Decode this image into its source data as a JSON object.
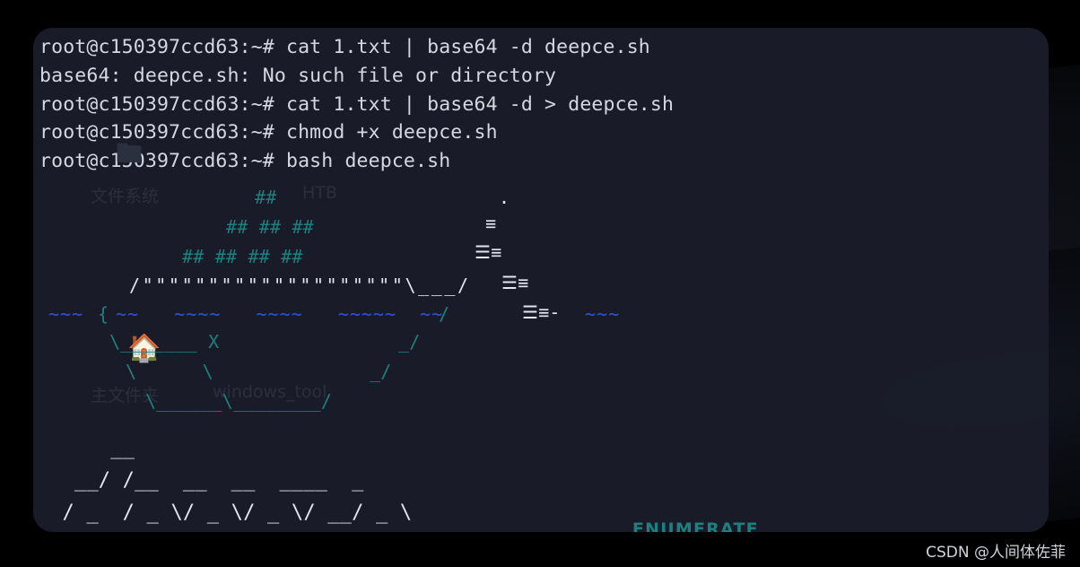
{
  "window": {
    "title": "root@c150397ccd63: ~",
    "background_color": "#1a1d29",
    "corner_radius": "22px"
  },
  "desktop": {
    "background_color": "#000000",
    "icons": [
      {
        "label": "文件系统",
        "glyph": "🖿",
        "name": "filesystem"
      },
      {
        "label": "主文件夹",
        "glyph": "🏠",
        "name": "home-folder"
      },
      {
        "label": "windows_tool",
        "glyph": "🗀",
        "name": "windows-tool-folder"
      },
      {
        "label": "HTB",
        "glyph": "🗀",
        "name": "htb-folder"
      }
    ]
  },
  "terminal": {
    "prompt": "root@c150397ccd63:~#",
    "text_color": "#d4d8e0",
    "lines": [
      {
        "type": "prompt",
        "prompt": "root@c150397ccd63:~#",
        "command": "cat 1.txt | base64 -d deepce.sh"
      },
      {
        "type": "output",
        "text": "base64: deepce.sh: No such file or directory"
      },
      {
        "type": "prompt",
        "prompt": "root@c150397ccd63:~#",
        "command": "cat 1.txt | base64 -d > deepce.sh"
      },
      {
        "type": "prompt",
        "prompt": "root@c150397ccd63:~#",
        "command": "chmod +x deepce.sh"
      },
      {
        "type": "prompt",
        "prompt": "root@c150397ccd63:~#",
        "command": "bash deepce.sh"
      }
    ],
    "rendered_lines": [
      "root@c150397ccd63:~# cat 1.txt | base64 -d deepce.sh",
      "base64: deepce.sh: No such file or directory",
      "root@c150397ccd63:~# cat 1.txt | base64 -d > deepce.sh",
      "root@c150397ccd63:~# chmod +x deepce.sh",
      "root@c150397ccd63:~# bash deepce.sh"
    ]
  },
  "banner": {
    "program": "deepce",
    "tagline": "ENUMERATE",
    "tagline_color": "#1f7f80",
    "colors": {
      "hull": "#1f7f80",
      "deck": "#e2e6ee",
      "waves": "#2a55d8",
      "smoke": "#e2e6ee",
      "containers": "#1f7f80"
    },
    "art_lines": [
      "                    ##                     .",
      "              ## ## ##                    ==",
      "           ## ## ## ##                  =====",
      "       /\"\"\"\"\"\"\"\"\"\"\"\"\"\"\"\"\"\"\"\\___/ =======",
      "  ~~ {~~ ~~~~ ~~~~ ~~~~~ ~~ /  ===-  ~~~",
      "    \\______ X          _/",
      "     \\    \\        _/",
      "      \\____\\______/",
      "",
      "      ___ /_/ __  __  __  ___ / _ \\",
      "     / _   / _ \\/ _ \\/ _ \\/ __/ / _ \\"
    ]
  },
  "watermark": {
    "text": "CSDN @人间体佐菲",
    "color": "#cfd3da"
  }
}
